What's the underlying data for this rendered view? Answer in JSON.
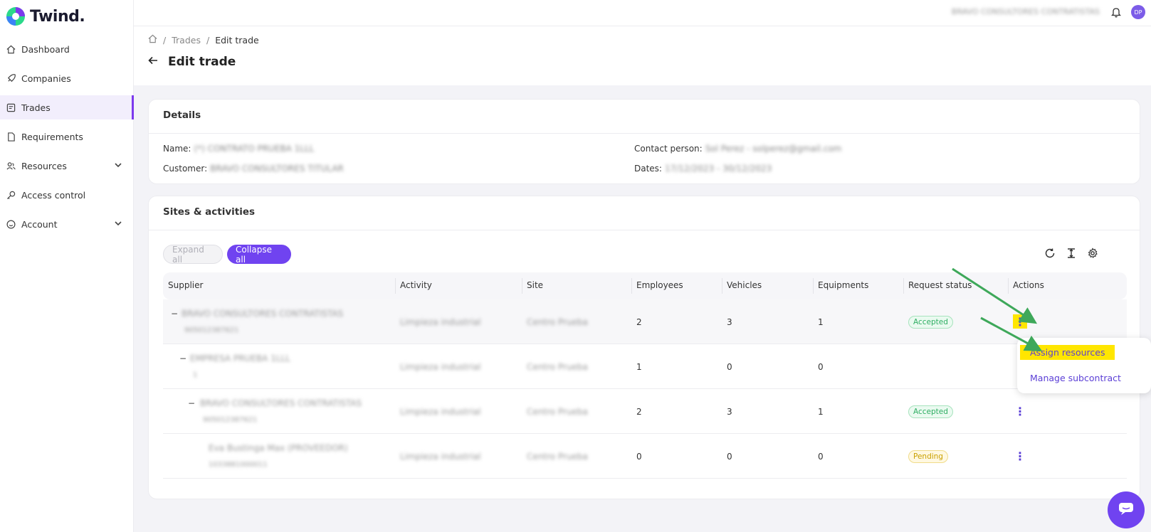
{
  "app": {
    "name": "Twind.",
    "colors": {
      "accent": "#7043f0",
      "active_bg": "#f2eefc",
      "highlight": "#ffe600",
      "arrow": "#3ea85a"
    }
  },
  "sidebar": {
    "items": [
      {
        "label": "Dashboard",
        "icon": "home-icon"
      },
      {
        "label": "Companies",
        "icon": "rocket-icon"
      },
      {
        "label": "Trades",
        "icon": "trades-icon",
        "active": true
      },
      {
        "label": "Requirements",
        "icon": "document-icon"
      },
      {
        "label": "Resources",
        "icon": "users-icon",
        "expandable": true
      },
      {
        "label": "Access control",
        "icon": "key-icon"
      },
      {
        "label": "Account",
        "icon": "smile-icon",
        "expandable": true
      }
    ]
  },
  "topbar": {
    "user_name": "BRAVO CONSULTORES CONTRATISTAS",
    "avatar": "DP"
  },
  "breadcrumb": {
    "home_icon": "home-icon",
    "trades": "Trades",
    "current": "Edit trade",
    "sep": "/"
  },
  "page": {
    "title": "Edit trade"
  },
  "details": {
    "title": "Details",
    "name_label": "Name:",
    "name_value": "(*) CONTRATO PRUEBA 1LLL",
    "customer_label": "Customer:",
    "customer_value": "BRAVO CONSULTORES TITULAR",
    "contact_label": "Contact person:",
    "contact_value": "Sol Perez - solperez@gmail.com",
    "dates_label": "Dates:",
    "dates_value": "17/12/2023 - 30/12/2023"
  },
  "sites": {
    "title": "Sites & activities",
    "expand_all": "Expand all",
    "collapse_all": "Collapse all",
    "columns": [
      "Supplier",
      "Activity",
      "Site",
      "Employees",
      "Vehicles",
      "Equipments",
      "Request status",
      "Actions"
    ],
    "rows": [
      {
        "minus": "−",
        "supplier": "BRAVO CONSULTORES CONTRATISTAS",
        "tax_id": "905012387621",
        "activity": "Limpieza industrial",
        "site": "Centro Prueba",
        "employees": "2",
        "vehicles": "3",
        "equipments": "1",
        "status": "Accepted",
        "kebab": "⋮"
      },
      {
        "minus": "−",
        "supplier": "EMPRESA PRUEBA 1LLL",
        "tax_id": "1",
        "activity": "Limpieza industrial",
        "site": "Centro Prueba",
        "employees": "1",
        "vehicles": "0",
        "equipments": "0",
        "status": "",
        "kebab": ""
      },
      {
        "minus": "−",
        "supplier": "BRAVO CONSULTORES CONTRATISTAS",
        "tax_id": "905012387621",
        "activity": "Limpieza industrial",
        "site": "Centro Prueba",
        "employees": "2",
        "vehicles": "3",
        "equipments": "1",
        "status": "Accepted",
        "kebab": "⋮"
      },
      {
        "minus": "",
        "supplier": "Eva Bustinga Max (PROVEEDOR)",
        "tax_id": "1033881000011",
        "activity": "Limpieza industrial",
        "site": "Centro Prueba",
        "employees": "0",
        "vehicles": "0",
        "equipments": "0",
        "status": "Pending",
        "kebab": "⋮"
      }
    ]
  },
  "menu": {
    "assign": "Assign resources",
    "manage": "Manage subcontract"
  }
}
